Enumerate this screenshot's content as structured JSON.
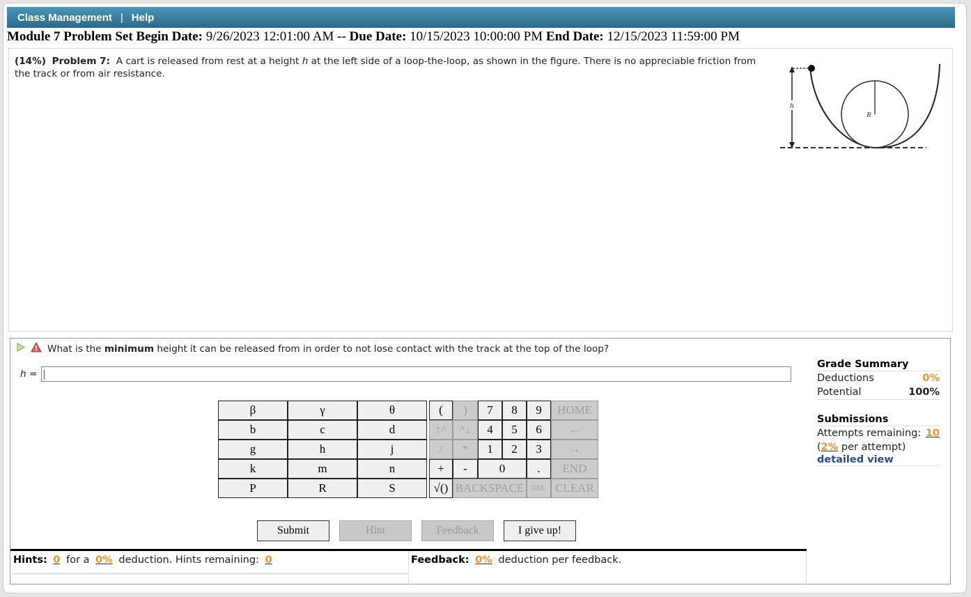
{
  "nav": {
    "items": [
      "Class Management",
      "Help"
    ],
    "separator": "|"
  },
  "dates": {
    "module": "Module 7 Problem Set",
    "begin_label": "Begin Date:",
    "begin_value": "9/26/2023 12:01:00 AM",
    "sep": "--",
    "due_label": "Due Date:",
    "due_value": "10/15/2023 10:00:00 PM",
    "end_label": "End Date:",
    "end_value": "12/15/2023 11:59:00 PM"
  },
  "problem": {
    "weight": "(14%)",
    "label": "Problem 7:",
    "text_before_var": "A cart is released from rest at a height",
    "var": "h",
    "text_after_var": "at the left side of a loop-the-loop, as shown in the figure. There is no appreciable friction from the track or from air resistance.",
    "figure": {
      "height_label": "h",
      "radius_label": "R"
    }
  },
  "question": {
    "icons": [
      "play-icon",
      "warning-icon"
    ],
    "text_before": "What is the",
    "text_bold": "minimum",
    "text_after": "height it can be released from in order to not lose contact with the track at the top of the loop?",
    "answer_var": "h",
    "answer_eq": "=",
    "answer_value": ""
  },
  "keypad": {
    "variables": [
      [
        "β",
        "γ",
        "θ"
      ],
      [
        "b",
        "c",
        "d"
      ],
      [
        "g",
        "h",
        "j"
      ],
      [
        "k",
        "m",
        "n"
      ],
      [
        "P",
        "R",
        "S"
      ]
    ],
    "row1": {
      "open_paren": "(",
      "close_paren": ")",
      "d7": "7",
      "d8": "8",
      "d9": "9",
      "home": "HOME"
    },
    "row2": {
      "pow_up": "↑^",
      "pow_down": "^↓",
      "d4": "4",
      "d5": "5",
      "d6": "6",
      "left": "←"
    },
    "row3": {
      "divide": "/",
      "multiply": "*",
      "d1": "1",
      "d2": "2",
      "d3": "3",
      "right": "→"
    },
    "row4": {
      "plus": "+",
      "minus": "-",
      "d0": "0",
      "dot": ".",
      "end": "END"
    },
    "row5": {
      "sqrt": "√()",
      "backspace": "BACKSPACE",
      "del": "DEL",
      "clear": "CLEAR"
    }
  },
  "actions": {
    "submit": "Submit",
    "hint": "Hint",
    "feedback": "Feedback",
    "give_up": "I give up!"
  },
  "hints": {
    "label": "Hints:",
    "count": "0",
    "for_a": "for a",
    "deduction": "0%",
    "deduction_text": "deduction. Hints remaining:",
    "remaining": "0"
  },
  "feedback": {
    "label": "Feedback:",
    "deduction": "0%",
    "text": "deduction per feedback."
  },
  "grade_summary": {
    "title": "Grade Summary",
    "deductions_label": "Deductions",
    "deductions_value": "0%",
    "potential_label": "Potential",
    "potential_value": "100%"
  },
  "submissions": {
    "title": "Submissions",
    "attempts_label": "Attempts remaining:",
    "attempts_value": "10",
    "per_attempt_value": "2%",
    "per_attempt_text": "per attempt)",
    "detailed_view": "detailed view"
  },
  "colors": {
    "header_top": "#4b95b8",
    "header_bottom": "#2b6a88",
    "accent_orange": "#f0932a",
    "link_blue": "#2b4f8a"
  }
}
